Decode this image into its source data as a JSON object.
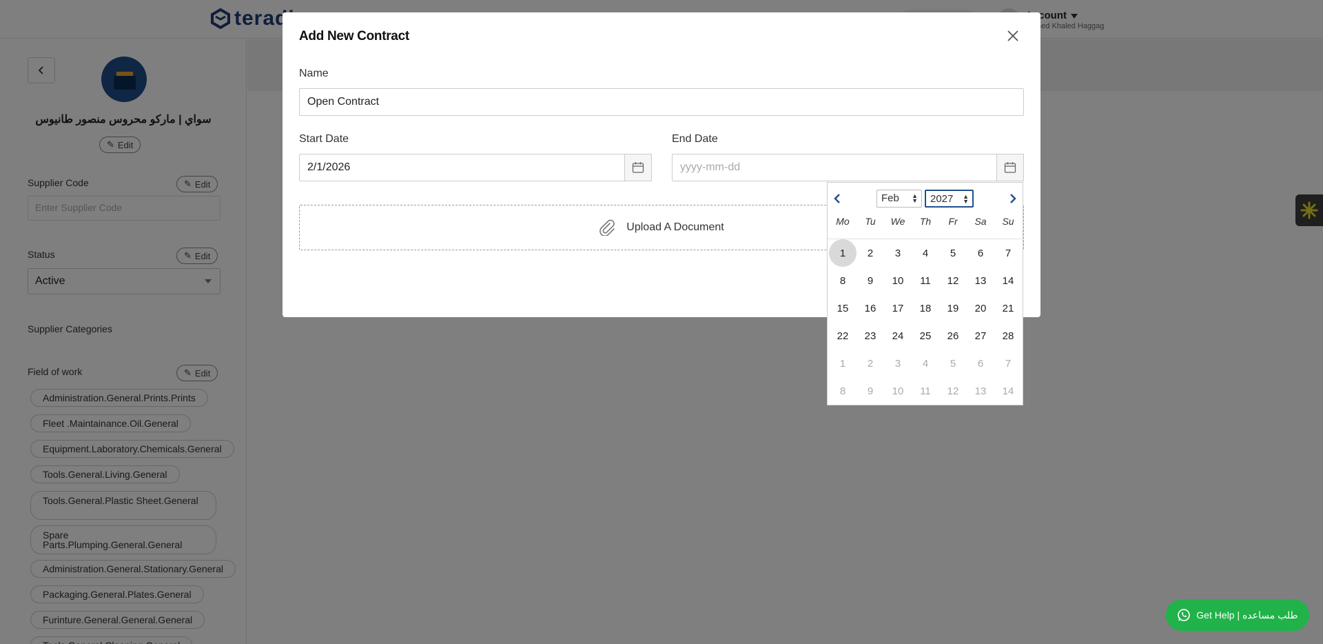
{
  "app": {
    "logo_text": "teradi",
    "account": {
      "label": "Account",
      "user": "Hamed Khaled Haggag"
    }
  },
  "sidebar": {
    "supplier_name": "سواي | ماركو محروس منصور طانيوس",
    "edit_label": "Edit",
    "supplier_code": {
      "label": "Supplier Code",
      "placeholder": "Enter Supplier Code",
      "edit_label": "Edit"
    },
    "status": {
      "label": "Status",
      "value": "Active",
      "edit_label": "Edit"
    },
    "categories_label": "Supplier Categories",
    "field_of_work": {
      "label": "Field of work",
      "edit_label": "Edit",
      "chips": [
        "Administration.General.Prints.Prints",
        "Fleet .Maintainance.Oil.General",
        "Equipment.Laboratory.Chemicals.General",
        "Tools.General.Living.General",
        "Tools.General.Plastic Sheet.General",
        "Spare Parts.Plumping.General.General",
        "Administration.General.Stationary.General",
        "Packaging.General.Plates.General",
        "Furinture.General.General.General",
        "Tools.General.Cleaning.General"
      ]
    }
  },
  "modal": {
    "title": "Add New Contract",
    "name_label": "Name",
    "name_value": "Open Contract",
    "start_date_label": "Start Date",
    "start_date_value": "2/1/2026",
    "end_date_label": "End Date",
    "end_date_placeholder": "yyyy-mm-dd",
    "upload_label": "Upload A Document"
  },
  "datepicker": {
    "month": "Feb",
    "year": "2027",
    "weekdays": [
      "Mo",
      "Tu",
      "We",
      "Th",
      "Fr",
      "Sa",
      "Su"
    ],
    "weeks": [
      [
        {
          "d": "1",
          "out": false,
          "sel": true
        },
        {
          "d": "2",
          "out": false
        },
        {
          "d": "3",
          "out": false
        },
        {
          "d": "4",
          "out": false
        },
        {
          "d": "5",
          "out": false
        },
        {
          "d": "6",
          "out": false
        },
        {
          "d": "7",
          "out": false
        }
      ],
      [
        {
          "d": "8",
          "out": false
        },
        {
          "d": "9",
          "out": false
        },
        {
          "d": "10",
          "out": false
        },
        {
          "d": "11",
          "out": false
        },
        {
          "d": "12",
          "out": false
        },
        {
          "d": "13",
          "out": false
        },
        {
          "d": "14",
          "out": false
        }
      ],
      [
        {
          "d": "15",
          "out": false
        },
        {
          "d": "16",
          "out": false
        },
        {
          "d": "17",
          "out": false
        },
        {
          "d": "18",
          "out": false
        },
        {
          "d": "19",
          "out": false
        },
        {
          "d": "20",
          "out": false
        },
        {
          "d": "21",
          "out": false
        }
      ],
      [
        {
          "d": "22",
          "out": false
        },
        {
          "d": "23",
          "out": false
        },
        {
          "d": "24",
          "out": false
        },
        {
          "d": "25",
          "out": false
        },
        {
          "d": "26",
          "out": false
        },
        {
          "d": "27",
          "out": false
        },
        {
          "d": "28",
          "out": false
        }
      ],
      [
        {
          "d": "1",
          "out": true
        },
        {
          "d": "2",
          "out": true
        },
        {
          "d": "3",
          "out": true
        },
        {
          "d": "4",
          "out": true
        },
        {
          "d": "5",
          "out": true
        },
        {
          "d": "6",
          "out": true
        },
        {
          "d": "7",
          "out": true
        }
      ],
      [
        {
          "d": "8",
          "out": true
        },
        {
          "d": "9",
          "out": true
        },
        {
          "d": "10",
          "out": true
        },
        {
          "d": "11",
          "out": true
        },
        {
          "d": "12",
          "out": true
        },
        {
          "d": "13",
          "out": true
        },
        {
          "d": "14",
          "out": true
        }
      ]
    ]
  },
  "help": {
    "label": "Get Help | طلب مساعده"
  },
  "colors": {
    "brand": "#1f3c7a",
    "help_green": "#21b24a",
    "overlay": "#000000"
  }
}
